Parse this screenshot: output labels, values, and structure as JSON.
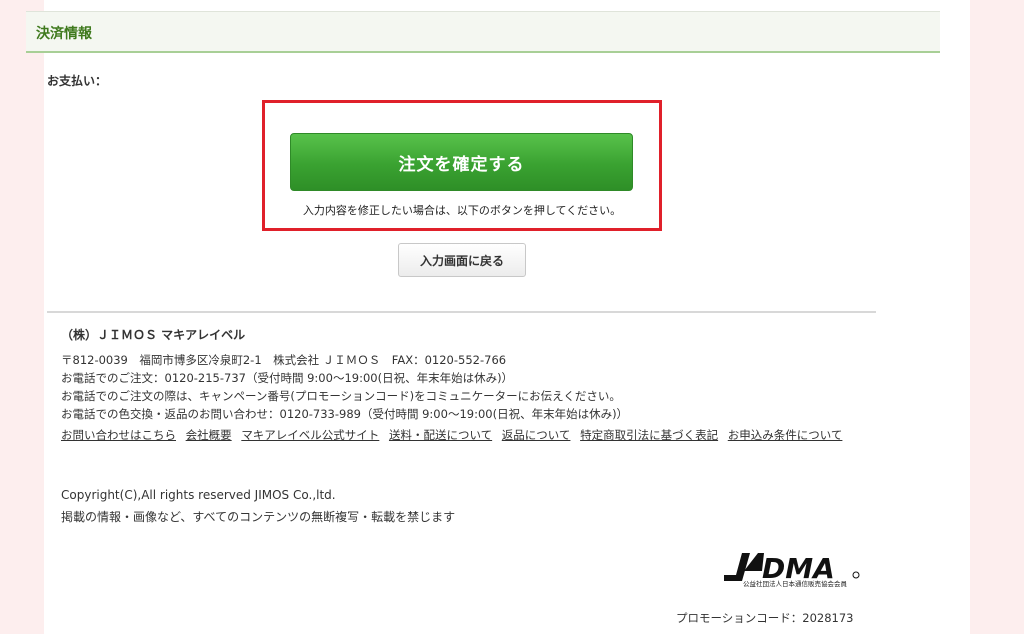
{
  "section": {
    "title": "決済情報"
  },
  "payment": {
    "label": "お支払い："
  },
  "confirm": {
    "button_label": "注文を確定する",
    "note": "入力内容を修正したい場合は、以下のボタンを押してください。"
  },
  "back": {
    "button_label": "入力画面に戻る"
  },
  "footer": {
    "company": "（株）ＪＩＭＯＳ マキアレイベル",
    "lines": [
      "〒812-0039　福岡市博多区冷泉町2-1　株式会社 ＪＩＭＯＳ　FAX：0120-552-766",
      "お電話でのご注文：0120-215-737（受付時間 9:00～19:00(日祝、年末年始は休み)）",
      "お電話でのご注文の際は、キャンペーン番号(プロモーションコード)をコミュニケーターにお伝えください。",
      "お電話での色交換・返品のお問い合わせ：0120-733-989（受付時間 9:00～19:00(日祝、年末年始は休み)）"
    ],
    "links": [
      "お問い合わせはこちら",
      "会社概要",
      "マキアレイベル公式サイト",
      "送料・配送について",
      "返品について",
      "特定商取引法に基づく表記",
      "お申込み条件について"
    ],
    "copyright": "Copyright(C),All rights reserved JIMOS Co.,ltd.",
    "notice": "掲載の情報・画像など、すべてのコンテンツの無断複写・転載を禁じます",
    "logo_text": "JADMA",
    "logo_caption": "公益社団法人日本通信販売協会会員",
    "promo": "プロモーションコード：2028173"
  },
  "colors": {
    "accent_green": "#3aa231",
    "header_green": "#3f7a1e",
    "highlight_red": "#e0202a",
    "page_bg": "#fdeeee"
  }
}
